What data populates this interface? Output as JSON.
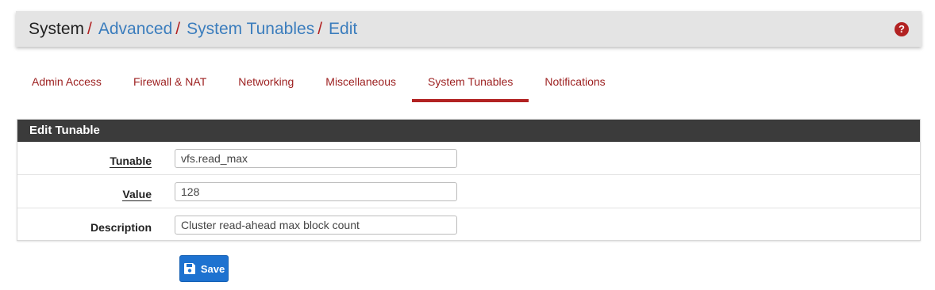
{
  "breadcrumb": {
    "items": [
      {
        "label": "System"
      },
      {
        "label": "Advanced"
      },
      {
        "label": "System Tunables"
      },
      {
        "label": "Edit"
      }
    ],
    "separator": "/"
  },
  "help_icon": "question-circle-icon",
  "tabs": [
    {
      "label": "Admin Access",
      "active": false
    },
    {
      "label": "Firewall & NAT",
      "active": false
    },
    {
      "label": "Networking",
      "active": false
    },
    {
      "label": "Miscellaneous",
      "active": false
    },
    {
      "label": "System Tunables",
      "active": true
    },
    {
      "label": "Notifications",
      "active": false
    }
  ],
  "panel": {
    "heading": "Edit Tunable",
    "fields": {
      "tunable": {
        "label": "Tunable",
        "value": "vfs.read_max"
      },
      "value": {
        "label": "Value",
        "value": "128"
      },
      "description": {
        "label": "Description",
        "value": "Cluster read-ahead max block count"
      }
    }
  },
  "save_button": {
    "label": "Save",
    "icon": "floppy-disk-icon"
  },
  "colors": {
    "accent_red": "#b22222",
    "link_blue": "#3b7dbd",
    "primary_button": "#1e72d0",
    "panel_heading": "#3b3b3b"
  }
}
